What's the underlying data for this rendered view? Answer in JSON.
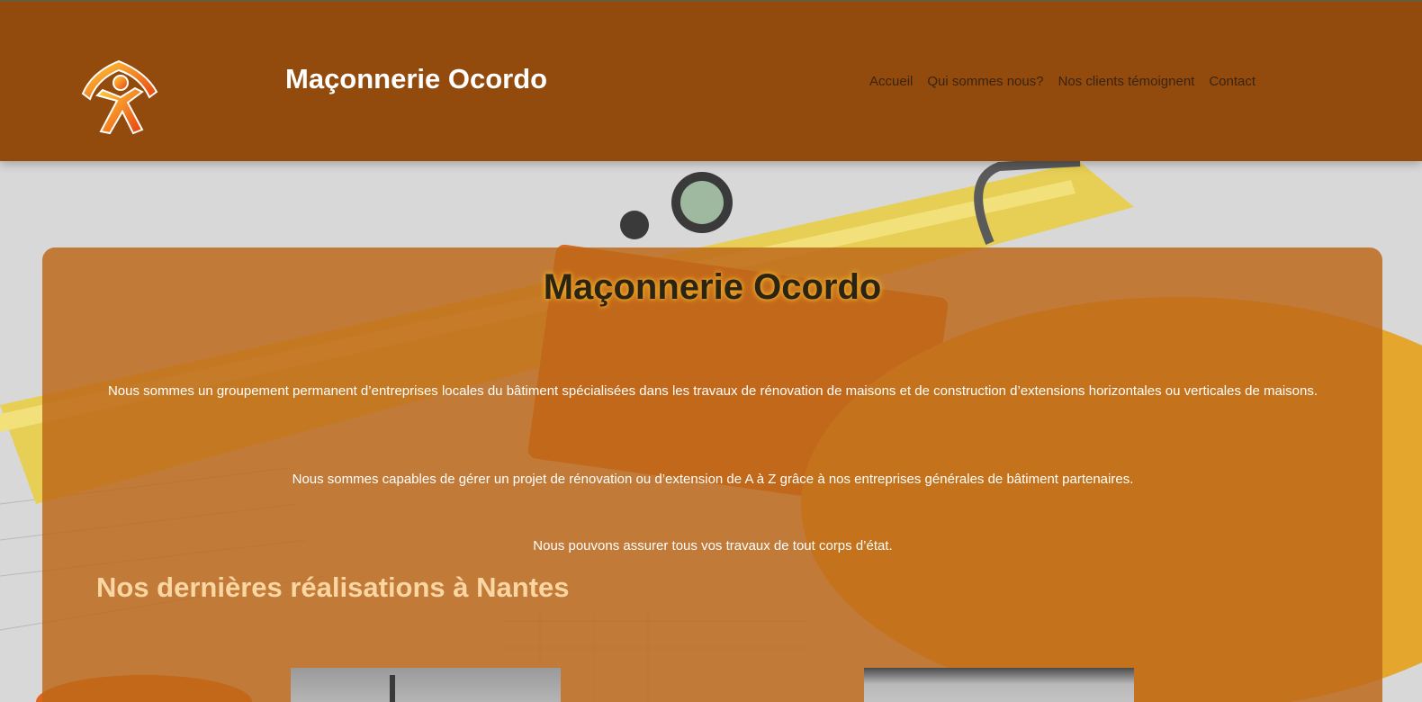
{
  "header": {
    "site_title": "Maçonnerie Ocordo",
    "nav": [
      {
        "label": "Accueil"
      },
      {
        "label": "Qui sommes nous?"
      },
      {
        "label": "Nos clients témoignent"
      },
      {
        "label": "Contact"
      }
    ]
  },
  "main": {
    "title": "Maçonnerie Ocordo",
    "paragraphs": [
      "Nous sommes un groupement permanent d’entreprises locales du bâtiment spécialisées dans les travaux de rénovation de maisons et de construction d’extensions horizontales ou verticales de maisons.",
      "Nous sommes capables de gérer un projet de rénovation ou d’extension de A à Z grâce à nos entreprises générales de bâtiment partenaires.",
      "Nous pouvons assurer tous vos travaux de tout corps d’état."
    ],
    "section_title": "Nos dernières réalisations à Nantes"
  },
  "colors": {
    "header_bg": "#924a0d",
    "card_bg": "#be6819",
    "section_title": "#fad6a2",
    "title_glow": "#f6b52c"
  },
  "icons": {
    "logo": "person-house-logo-icon"
  }
}
